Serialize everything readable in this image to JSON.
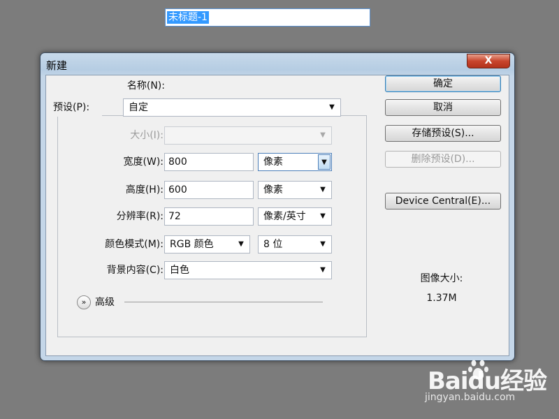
{
  "dialog": {
    "title": "新建",
    "close_label": "X",
    "name": {
      "label": "名称(N):",
      "value": "未标题-1"
    },
    "preset": {
      "label": "预设(P):",
      "value": "自定"
    },
    "size": {
      "label": "大小(I):",
      "value": ""
    },
    "width": {
      "label": "宽度(W):",
      "value": "800",
      "unit": "像素"
    },
    "height": {
      "label": "高度(H):",
      "value": "600",
      "unit": "像素"
    },
    "resolution": {
      "label": "分辨率(R):",
      "value": "72",
      "unit": "像素/英寸"
    },
    "color_mode": {
      "label": "颜色模式(M):",
      "value": "RGB 颜色",
      "depth": "8 位"
    },
    "background": {
      "label": "背景内容(C):",
      "value": "白色"
    },
    "advanced": {
      "label": "高级"
    },
    "buttons": {
      "ok": "确定",
      "cancel": "取消",
      "save_preset": "存储预设(S)...",
      "delete_preset": "删除预设(D)...",
      "device_central": "Device Central(E)..."
    },
    "image_size": {
      "label": "图像大小:",
      "value": "1.37M"
    }
  },
  "watermark": {
    "brand": "Baidu经验",
    "url": "jingyan.baidu.com"
  }
}
